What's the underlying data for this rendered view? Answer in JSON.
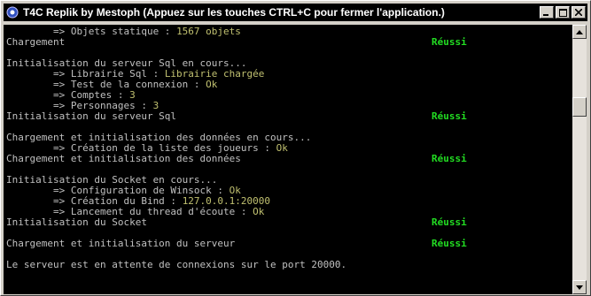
{
  "window": {
    "title": "T4C Replik by Mestoph (Appuez sur les touches CTRL+C pour fermer l'application.)",
    "icon": "console-app-icon",
    "buttons": [
      "minimize",
      "maximize",
      "close"
    ]
  },
  "colors": {
    "background": "#000000",
    "text": "#c0c0c0",
    "value": "#c0c070",
    "success": "#22dd22",
    "titlebar": "#000000"
  },
  "console": {
    "lines": [
      {
        "prefix": "        => Objets statique : ",
        "value": "1567 objets"
      },
      {
        "prefix": "Chargement",
        "value": "",
        "status": "Réussi"
      },
      {
        "prefix": "",
        "value": ""
      },
      {
        "prefix": "Initialisation du serveur Sql en cours...",
        "value": ""
      },
      {
        "prefix": "        => Librairie Sql : ",
        "value": "Librairie chargée"
      },
      {
        "prefix": "        => Test de la connexion : ",
        "value": "Ok"
      },
      {
        "prefix": "        => Comptes : ",
        "value": "3"
      },
      {
        "prefix": "        => Personnages : ",
        "value": "3"
      },
      {
        "prefix": "Initialisation du serveur Sql",
        "value": "",
        "status": "Réussi"
      },
      {
        "prefix": "",
        "value": ""
      },
      {
        "prefix": "Chargement et initialisation des données en cours...",
        "value": ""
      },
      {
        "prefix": "        => Création de la liste des joueurs : ",
        "value": "Ok"
      },
      {
        "prefix": "Chargement et initialisation des données",
        "value": "",
        "status": "Réussi"
      },
      {
        "prefix": "",
        "value": ""
      },
      {
        "prefix": "Initialisation du Socket en cours...",
        "value": ""
      },
      {
        "prefix": "        => Configuration de Winsock : ",
        "value": "Ok"
      },
      {
        "prefix": "        => Création du Bind : ",
        "value": "127.0.0.1:20000"
      },
      {
        "prefix": "        => Lancement du thread d'écoute : ",
        "value": "Ok"
      },
      {
        "prefix": "Initialisation du Socket",
        "value": "",
        "status": "Réussi"
      },
      {
        "prefix": "",
        "value": ""
      },
      {
        "prefix": "Chargement et initialisation du serveur",
        "value": "",
        "status": "Réussi"
      },
      {
        "prefix": "",
        "value": ""
      },
      {
        "prefix": "Le serveur est en attente de connexions sur le port 20000.",
        "value": ""
      }
    ]
  }
}
